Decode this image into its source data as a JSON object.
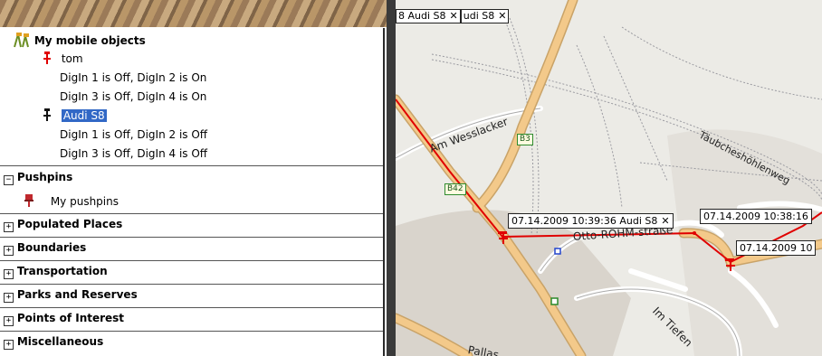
{
  "tree": {
    "mobile_objects": {
      "title": "My mobile objects",
      "items": [
        {
          "name": "tom",
          "lines": [
            "DigIn 1 is Off, DigIn 2 is On",
            "DigIn 3 is Off, DigIn 4 is On"
          ]
        },
        {
          "name": "Audi S8",
          "lines": [
            "DigIn 1 is Off, DigIn 2 is Off",
            "DigIn 3 is Off, DigIn 4 is Off"
          ]
        }
      ]
    },
    "pushpins": {
      "title": "Pushpins",
      "child": "My pushpins"
    },
    "categories": [
      "Populated Places",
      "Boundaries",
      "Transportation",
      "Parks and Reserves",
      "Points of Interest",
      "Miscellaneous"
    ]
  },
  "map": {
    "tabs": [
      "8 Audi S8",
      "udi S8"
    ],
    "labels": [
      "07.14.2009 10:39:36 Audi S8",
      "07.14.2009 10:38:16",
      "07.14.2009 10"
    ],
    "streets": [
      "Am Wesslacker",
      "Täubcheshöhlenweg",
      "Otto-RÖHM-straße",
      "Im Tiefen",
      "Pallas"
    ],
    "shields": [
      "B3",
      "B42"
    ]
  }
}
